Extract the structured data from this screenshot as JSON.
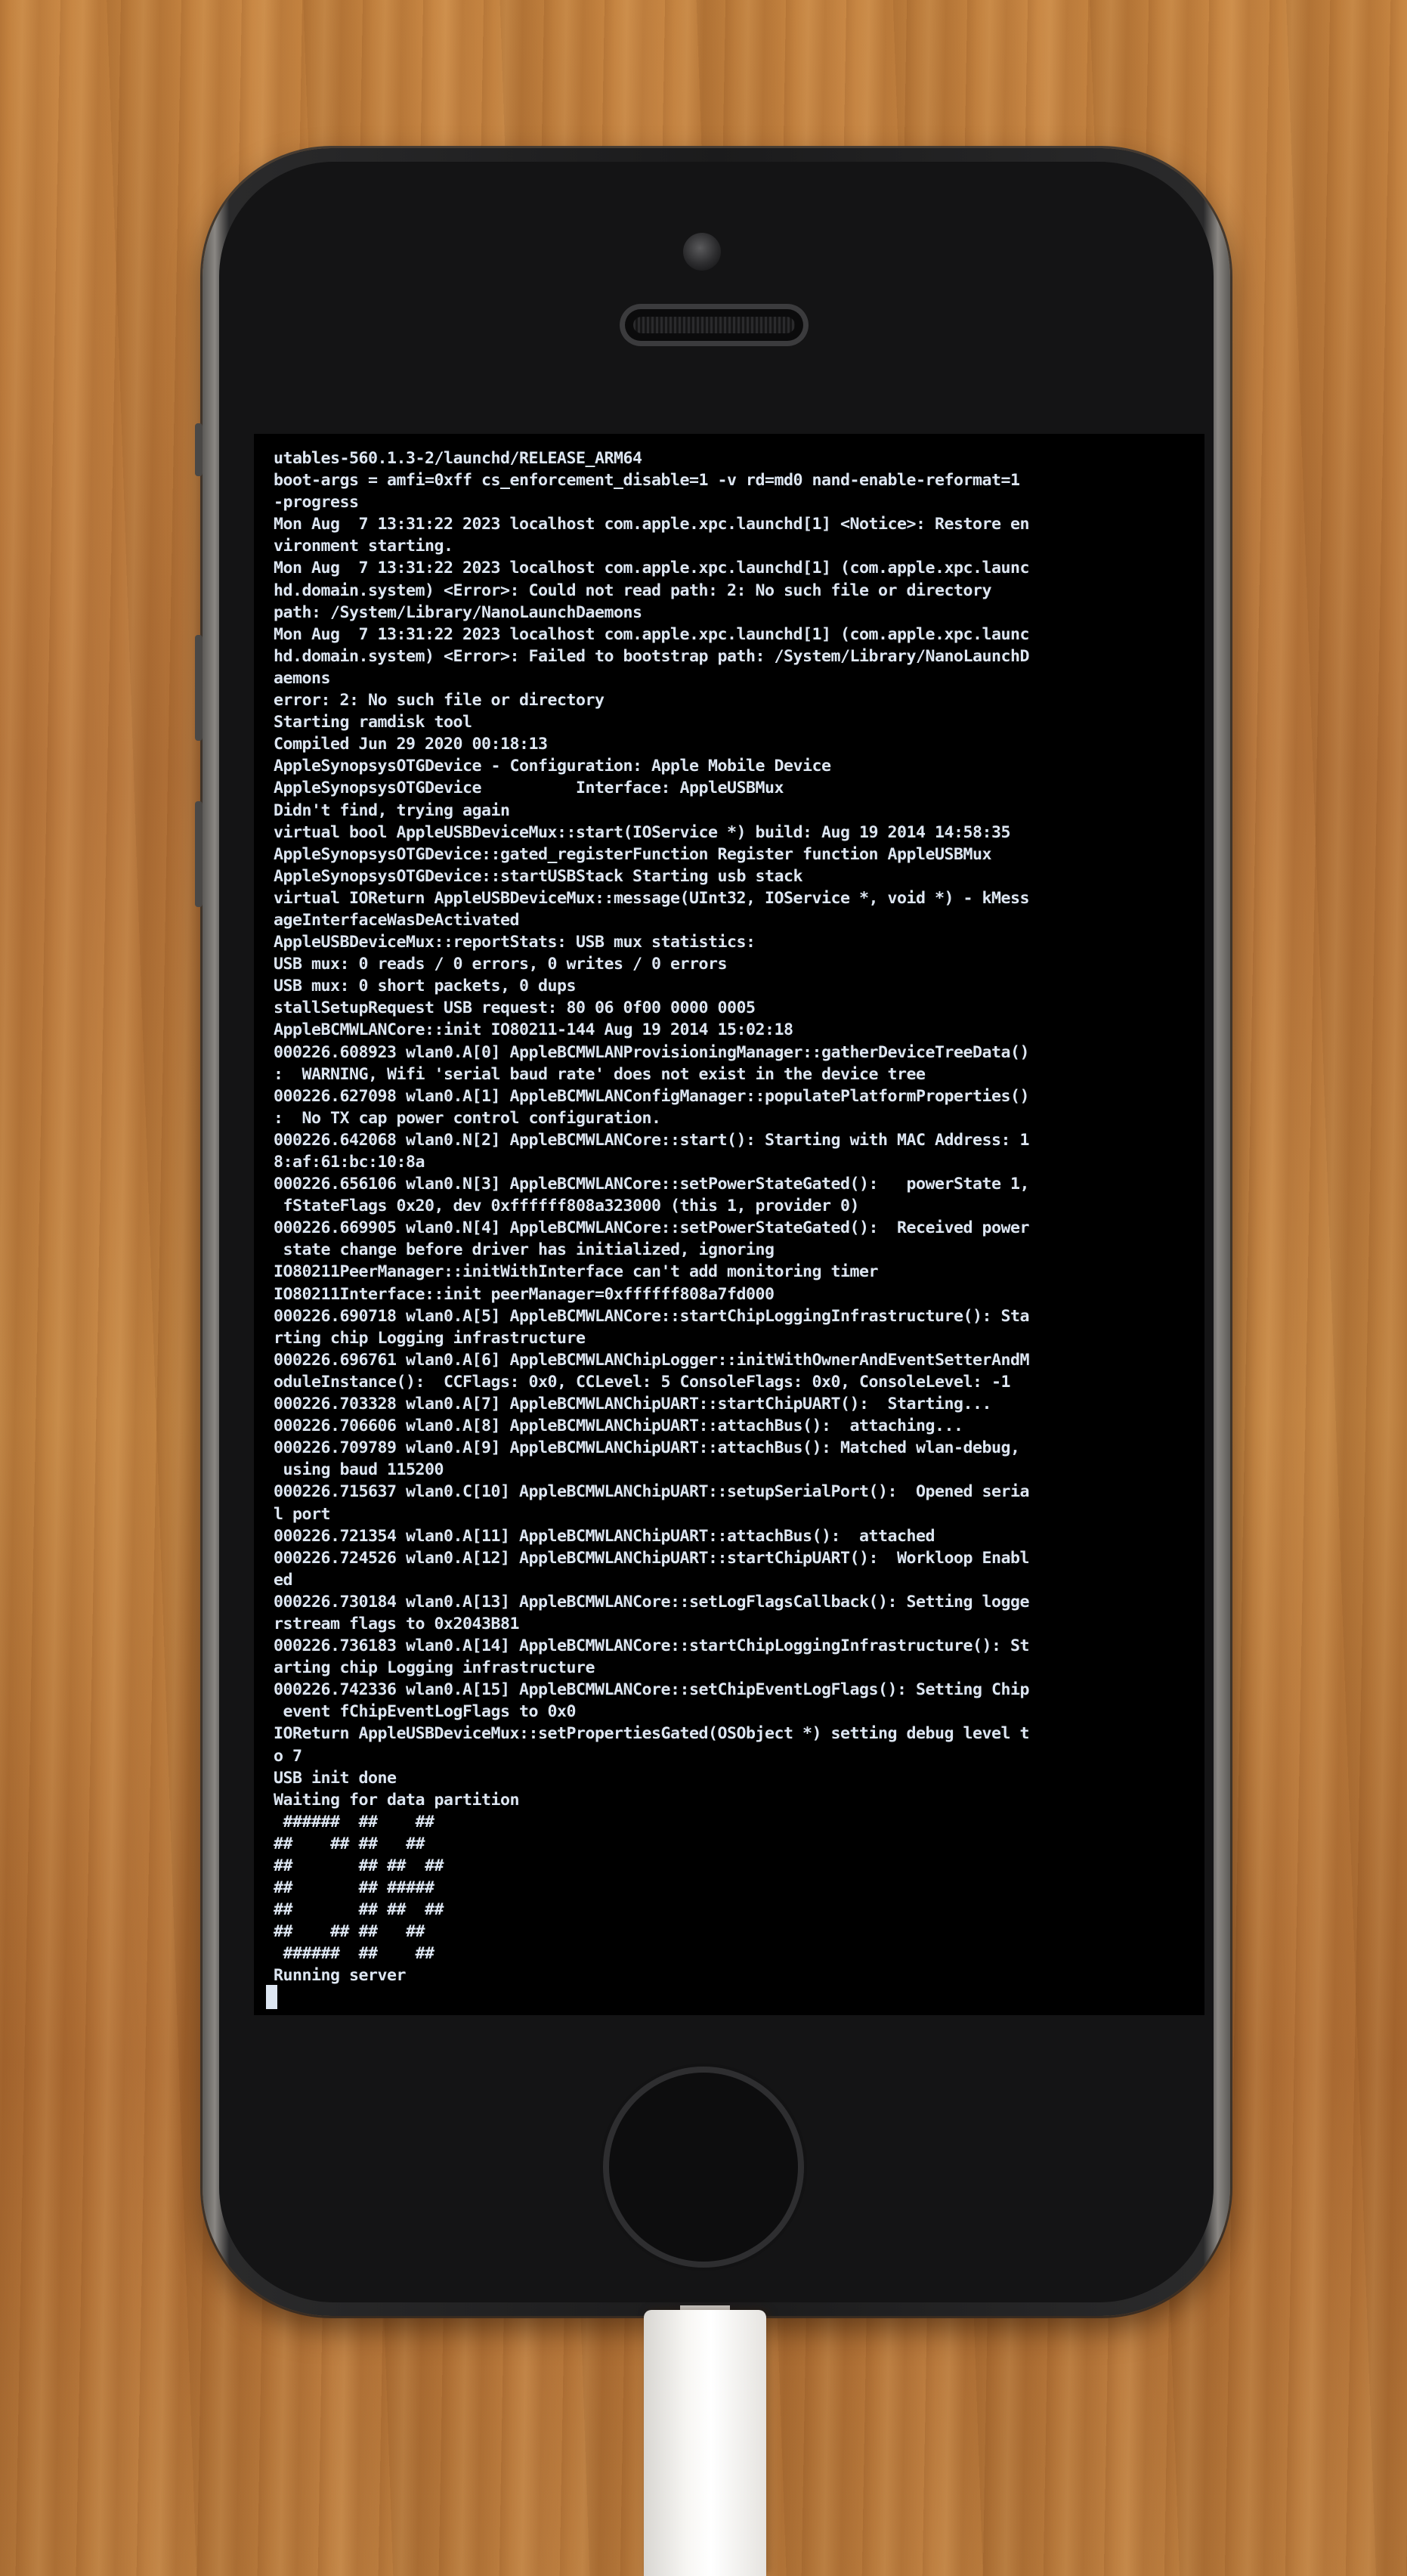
{
  "console": {
    "lines": [
      "utables-560.1.3-2/launchd/RELEASE_ARM64",
      "boot-args = amfi=0xff cs_enforcement_disable=1 -v rd=md0 nand-enable-reformat=1",
      "-progress",
      "Mon Aug  7 13:31:22 2023 localhost com.apple.xpc.launchd[1] <Notice>: Restore en",
      "vironment starting.",
      "Mon Aug  7 13:31:22 2023 localhost com.apple.xpc.launchd[1] (com.apple.xpc.launc",
      "hd.domain.system) <Error>: Could not read path: 2: No such file or directory",
      "path: /System/Library/NanoLaunchDaemons",
      "Mon Aug  7 13:31:22 2023 localhost com.apple.xpc.launchd[1] (com.apple.xpc.launc",
      "hd.domain.system) <Error>: Failed to bootstrap path: /System/Library/NanoLaunchD",
      "aemons",
      "error: 2: No such file or directory",
      "Starting ramdisk tool",
      "Compiled Jun 29 2020 00:18:13",
      "AppleSynopsysOTGDevice - Configuration: Apple Mobile Device",
      "AppleSynopsysOTGDevice          Interface: AppleUSBMux",
      "Didn't find, trying again",
      "virtual bool AppleUSBDeviceMux::start(IOService *) build: Aug 19 2014 14:58:35",
      "AppleSynopsysOTGDevice::gated_registerFunction Register function AppleUSBMux",
      "AppleSynopsysOTGDevice::startUSBStack Starting usb stack",
      "virtual IOReturn AppleUSBDeviceMux::message(UInt32, IOService *, void *) - kMess",
      "ageInterfaceWasDeActivated",
      "AppleUSBDeviceMux::reportStats: USB mux statistics:",
      "USB mux: 0 reads / 0 errors, 0 writes / 0 errors",
      "USB mux: 0 short packets, 0 dups",
      "stallSetupRequest USB request: 80 06 0f00 0000 0005",
      "AppleBCMWLANCore::init IO80211-144 Aug 19 2014 15:02:18",
      "000226.608923 wlan0.A[0] AppleBCMWLANProvisioningManager::gatherDeviceTreeData()",
      ":  WARNING, Wifi 'serial baud rate' does not exist in the device tree",
      "000226.627098 wlan0.A[1] AppleBCMWLANConfigManager::populatePlatformProperties()",
      ":  No TX cap power control configuration.",
      "000226.642068 wlan0.N[2] AppleBCMWLANCore::start(): Starting with MAC Address: 1",
      "8:af:61:bc:10:8a",
      "000226.656106 wlan0.N[3] AppleBCMWLANCore::setPowerStateGated():   powerState 1,",
      " fStateFlags 0x20, dev 0xffffff808a323000 (this 1, provider 0)",
      "000226.669905 wlan0.N[4] AppleBCMWLANCore::setPowerStateGated():  Received power",
      " state change before driver has initialized, ignoring",
      "IO80211PeerManager::initWithInterface can't add monitoring timer",
      "IO80211Interface::init peerManager=0xffffff808a7fd000",
      "000226.690718 wlan0.A[5] AppleBCMWLANCore::startChipLoggingInfrastructure(): Sta",
      "rting chip Logging infrastructure",
      "000226.696761 wlan0.A[6] AppleBCMWLANChipLogger::initWithOwnerAndEventSetterAndM",
      "oduleInstance():  CCFlags: 0x0, CCLevel: 5 ConsoleFlags: 0x0, ConsoleLevel: -1",
      "000226.703328 wlan0.A[7] AppleBCMWLANChipUART::startChipUART():  Starting...",
      "000226.706606 wlan0.A[8] AppleBCMWLANChipUART::attachBus():  attaching...",
      "000226.709789 wlan0.A[9] AppleBCMWLANChipUART::attachBus(): Matched wlan-debug,",
      " using baud 115200",
      "000226.715637 wlan0.C[10] AppleBCMWLANChipUART::setupSerialPort():  Opened seria",
      "l port",
      "000226.721354 wlan0.A[11] AppleBCMWLANChipUART::attachBus():  attached",
      "000226.724526 wlan0.A[12] AppleBCMWLANChipUART::startChipUART():  Workloop Enabl",
      "ed",
      "000226.730184 wlan0.A[13] AppleBCMWLANCore::setLogFlagsCallback(): Setting logge",
      "rstream flags to 0x2043B81",
      "000226.736183 wlan0.A[14] AppleBCMWLANCore::startChipLoggingInfrastructure(): St",
      "arting chip Logging infrastructure",
      "000226.742336 wlan0.A[15] AppleBCMWLANCore::setChipEventLogFlags(): Setting Chip",
      " event fChipEventLogFlags to 0x0",
      "IOReturn AppleUSBDeviceMux::setPropertiesGated(OSObject *) setting debug level t",
      "o 7",
      "USB init done",
      "Waiting for data partition",
      " ######  ##    ##",
      "##    ## ##   ##",
      "##       ## ##  ##",
      "##       ## #####",
      "##       ## ##  ##",
      "##    ## ##   ##",
      " ######  ##    ##",
      "Running server"
    ]
  }
}
